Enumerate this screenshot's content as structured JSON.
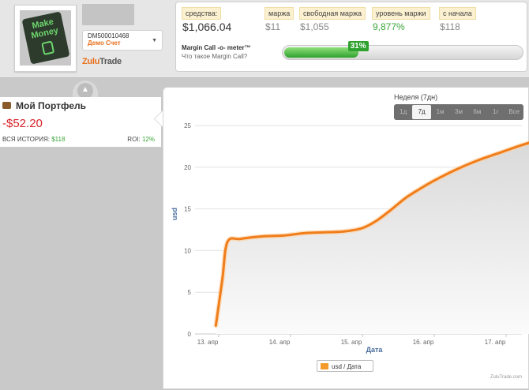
{
  "account": {
    "avatar_text": "Make Money",
    "id": "DM500010468",
    "type": "Демо Счет",
    "brand_part1": "Zulu",
    "brand_part2": "Trade"
  },
  "stats": [
    {
      "label": "средства:",
      "value": "$1,066.04"
    },
    {
      "label": "маржа",
      "value": "$11"
    },
    {
      "label": "свободная маржа",
      "value": "$1,055"
    },
    {
      "label": "уровень маржи",
      "value": "9,877%"
    },
    {
      "label": "с начала",
      "value": "$118"
    }
  ],
  "margin_call": {
    "title": "Margin Call -o- meter™",
    "link": "Что такое Margin Call?",
    "percent_label": "31%",
    "percent": 31
  },
  "portfolio": {
    "title": "Мой Портфель",
    "value": "-$52.20",
    "history_label": "ВСЯ ИСТОРИЯ:",
    "history_value": "$118",
    "roi_label": "ROI:",
    "roi_value": "12%"
  },
  "period": {
    "title": "Неделя (7дн)",
    "options": [
      "1д",
      "7д",
      "1м",
      "3м",
      "6м",
      "1г",
      "Все"
    ],
    "selected": "7д"
  },
  "colors": {
    "line": "#f07d1a",
    "accent_green": "#3aa63a",
    "negative": "#d8232a"
  },
  "chart_data": {
    "type": "area",
    "xlabel": "Дата",
    "ylabel": "usd",
    "ylim": [
      0,
      25
    ],
    "yticks": [
      0,
      5,
      10,
      15,
      20,
      25
    ],
    "xticks": [
      {
        "label": "13. апр",
        "x": 0
      },
      {
        "label": "14. апр",
        "x": 1
      },
      {
        "label": "15. апр",
        "x": 2
      },
      {
        "label": "16. апр",
        "x": 3
      },
      {
        "label": "17. апр",
        "x": 4
      }
    ],
    "series": [
      {
        "name": "usd / Дата",
        "x": [
          -0.04,
          0.05,
          0.12,
          0.3,
          0.6,
          0.9,
          1.2,
          1.5,
          1.75,
          2.0,
          2.2,
          2.4,
          2.6,
          2.8,
          3.0,
          3.3,
          3.6,
          3.9,
          4.2,
          4.5
        ],
        "y": [
          1.0,
          6.5,
          11.0,
          11.4,
          11.7,
          11.8,
          12.1,
          12.2,
          12.3,
          12.7,
          13.6,
          14.9,
          16.3,
          17.4,
          18.4,
          19.7,
          20.8,
          21.7,
          22.6,
          23.4
        ]
      }
    ],
    "grid": true,
    "legend": "bottom-center",
    "credit": "ZuluTrade.com"
  }
}
